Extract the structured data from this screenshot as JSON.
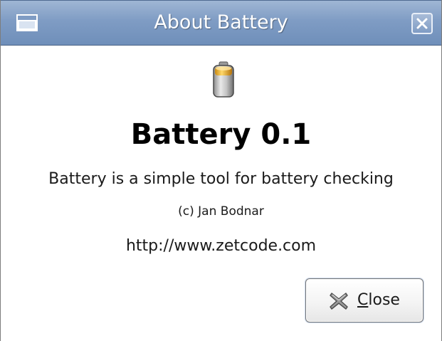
{
  "window": {
    "title": "About Battery"
  },
  "about": {
    "app_icon": "battery-icon",
    "name_version": "Battery 0.1",
    "comments": "Battery is a simple tool for battery checking",
    "copyright": "(c) Jan Bodnar",
    "website": "http://www.zetcode.com"
  },
  "buttons": {
    "close_mnemonic": "C",
    "close_rest": "lose",
    "close_icon": "close-x-icon"
  },
  "colors": {
    "titlebar": "#7f9cc4",
    "window_bg": "#ffffff"
  }
}
